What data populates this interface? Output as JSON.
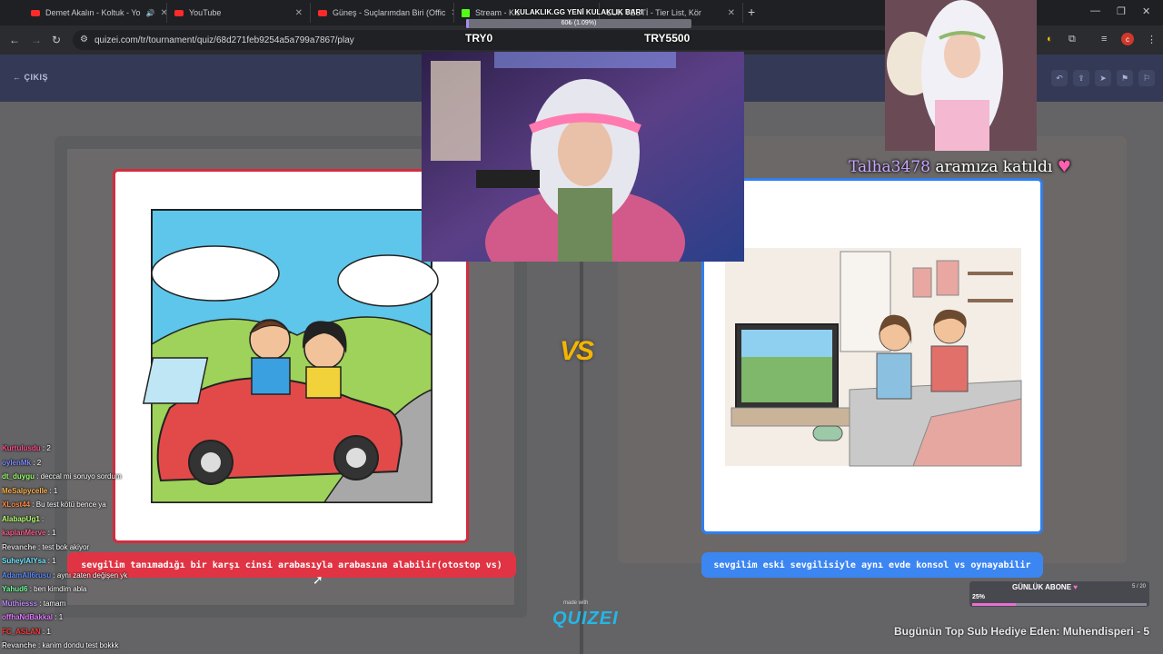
{
  "browser": {
    "tabs": [
      {
        "title": "Demet Akalın - Koltuk - Yo",
        "icon": "youtube-icon"
      },
      {
        "title": "YouTube",
        "icon": "youtube-icon"
      },
      {
        "title": "Güneş - Suçlarımdan Biri (Offic",
        "icon": "youtube-icon"
      },
      {
        "title": "Stream - Kic",
        "icon": "kick-icon"
      },
      {
        "title": "LUK TESTİ - Tier List, Kör",
        "icon": "quizei-icon"
      }
    ],
    "url": "quizei.com/tr/tournament/quiz/68d271feb9254a5a799a7867/play"
  },
  "site": {
    "exit_label": "ÇIKIŞ",
    "made_with": "made with",
    "logo": "QUIZEI"
  },
  "quiz": {
    "vs_label": "VS",
    "left_option": "sevgilim tanımadığı bir karşı cinsi arabasıyla arabasına alabilir(otostop vs)",
    "right_option": "sevgilim eski sevgilisiyle aynı evde konsol vs oynayabilir"
  },
  "overlay": {
    "kulaklik_title": "KULAKLIK.GG YENİ KULAKLIK BARI",
    "kulaklik_value": "60₺ (1.09%)",
    "kulaklik_progress": 0.0109,
    "try_left": "TRY0",
    "try_right": "TRY5500",
    "join_user": "Talha3478",
    "join_text": "aramıza katıldı",
    "abone_title": "GÜNLÜK ABONE",
    "abone_count": "5 / 20",
    "abone_pct": "25%",
    "abone_progress": 0.25,
    "top_sub": "Bugünün Top Sub Hediye Eden: Muhendisperi - 5"
  },
  "chat": [
    {
      "user": "Kurtulusdu",
      "msg": ": 2",
      "color": "#ff4f8b"
    },
    {
      "user": "oylenMk",
      "msg": ": 2",
      "color": "#7f8cff"
    },
    {
      "user": "dt_duygu",
      "msg": ": deccal mi soruyo sordum",
      "color": "#9cff6e"
    },
    {
      "user": "MeSalpycelle",
      "msg": ": 1",
      "color": "#ffb347"
    },
    {
      "user": "XLost44",
      "msg": ": Bu test kötü bence ya",
      "color": "#ff8a3d"
    },
    {
      "user": "AlabapUg1",
      "msg": ":",
      "color": "#b6ff6b"
    },
    {
      "user": "kaplanMerve",
      "msg": ": 1",
      "color": "#ff5c8a"
    },
    {
      "user": "Revanche",
      "msg": ": test bok akiyor",
      "color": "#d9d9d9"
    },
    {
      "user": "SuheylAlYsa",
      "msg": ": 1",
      "color": "#6ee7ff"
    },
    {
      "user": "AdamAll6rusu",
      "msg": ": aynı zaten değişen yk",
      "color": "#5a8bff"
    },
    {
      "user": "Yahud6",
      "msg": ": ben kimdim abla",
      "color": "#72ff9c"
    },
    {
      "user": "Muthiesss",
      "msg": ": tamam",
      "color": "#c38cff"
    },
    {
      "user": "offhaNdBakkal",
      "msg": ": 1",
      "color": "#e07bff"
    },
    {
      "user": "FC_ASLAN",
      "msg": ": 1",
      "color": "#ff3b3b"
    },
    {
      "user": "Revanche",
      "msg": ": kanim dondu test bokkk",
      "color": "#d9d9d9"
    }
  ],
  "colors": {
    "left_accent": "#e03444",
    "right_accent": "#3c86f2",
    "vs": "#f4b400"
  }
}
